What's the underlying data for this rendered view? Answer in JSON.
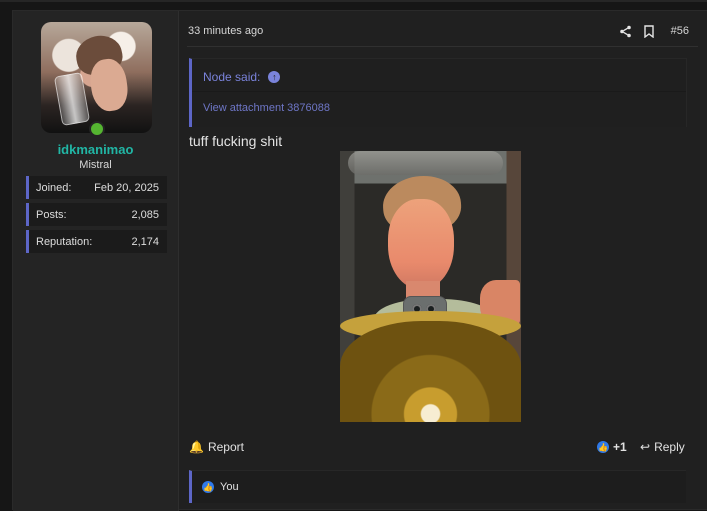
{
  "post": {
    "username": "idkmanimao",
    "user_title": "Mistral",
    "stats": [
      {
        "label": "Joined:",
        "value": "Feb 20, 2025"
      },
      {
        "label": "Posts:",
        "value": "2,085"
      },
      {
        "label": "Reputation:",
        "value": "2,174"
      }
    ],
    "timestamp": "33 minutes ago",
    "post_number": "#56",
    "quote": {
      "source": "Node said:",
      "attachment_link": "View attachment 3876088"
    },
    "message": "tuff fucking shit",
    "footer": {
      "report_label": "Report",
      "reaction_count": "+1",
      "reply_label": "Reply"
    },
    "reactions_text": "You"
  },
  "icons": {
    "share": "share-icon",
    "bookmark": "bookmark-icon",
    "arrow": "arrow-up-circle-icon",
    "report": "bell-icon",
    "like": "thumbs-up-icon",
    "reply": "reply-icon"
  },
  "colors": {
    "accent": "#5d66c7",
    "username": "#21b6a5",
    "online": "#55b531",
    "link": "#7a83db",
    "like": "#2f79e8"
  }
}
